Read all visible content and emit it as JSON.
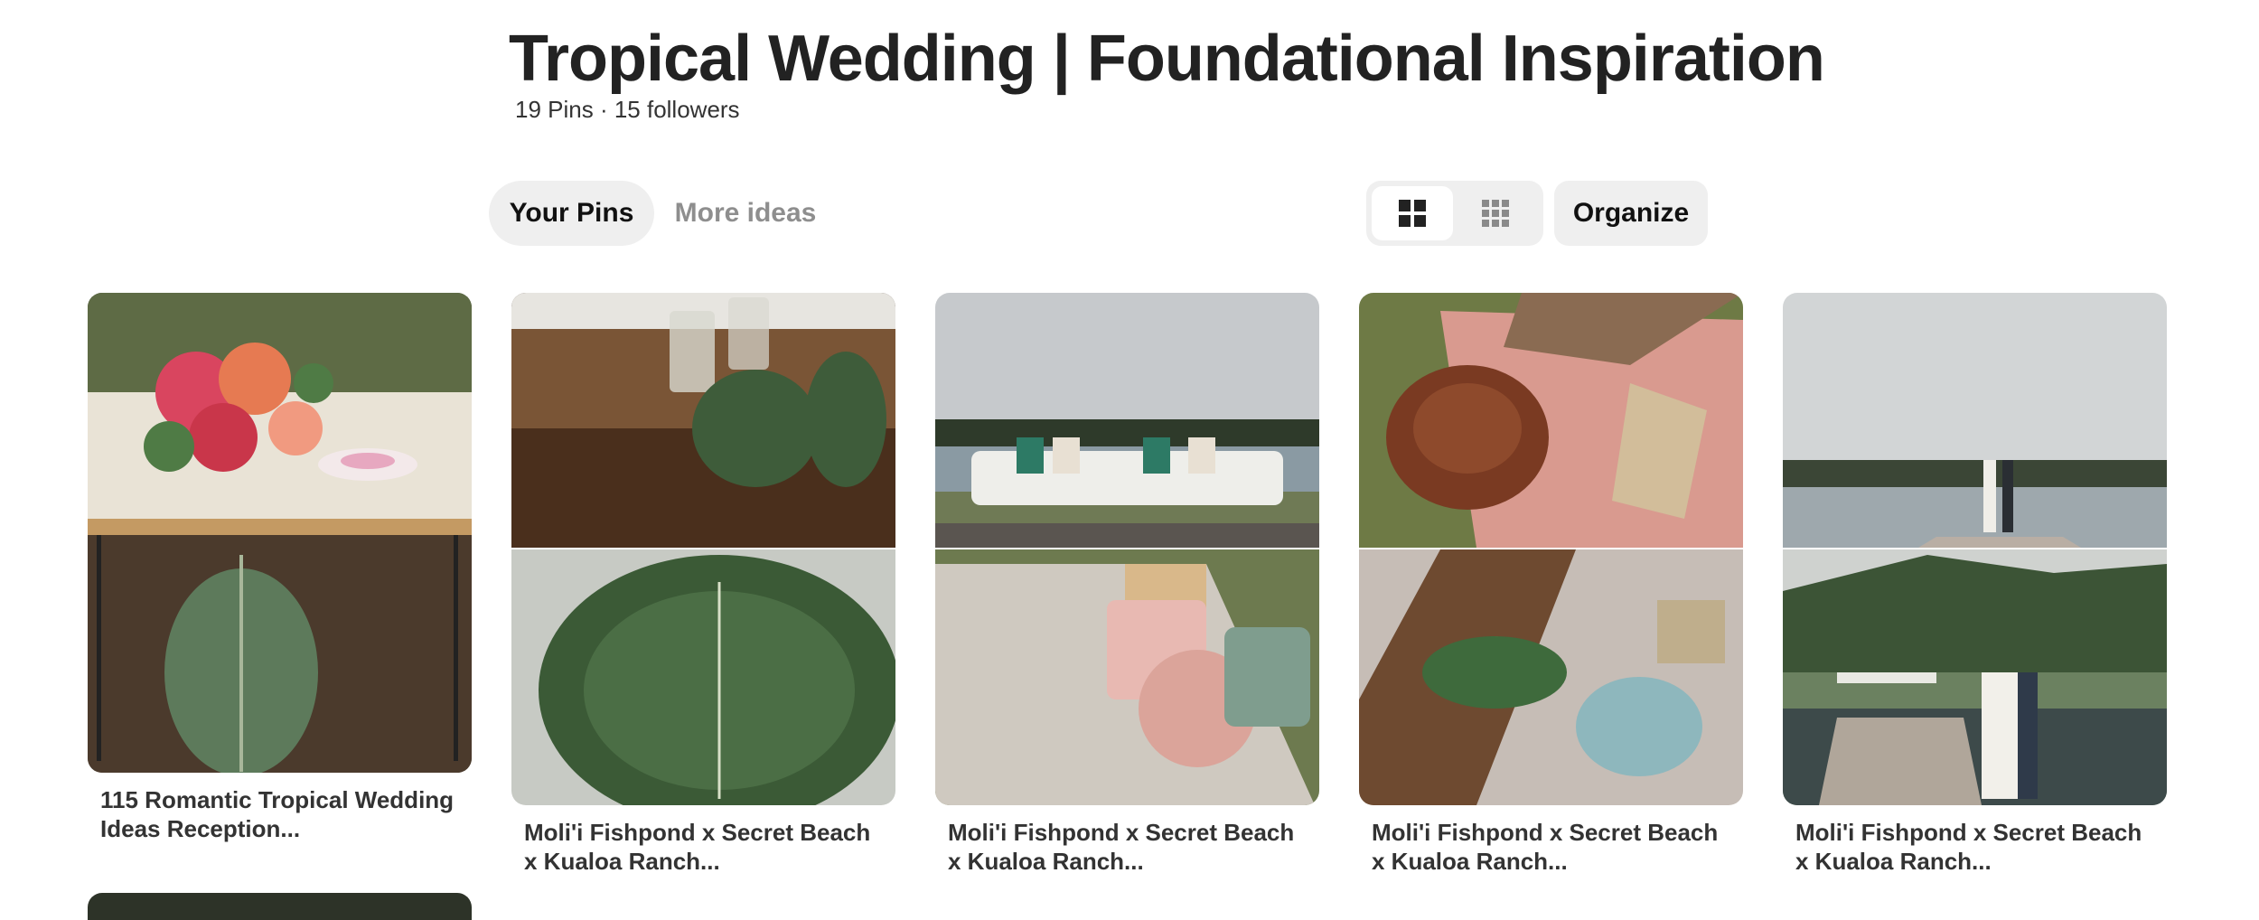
{
  "board": {
    "title": "Tropical Wedding | Foundational Inspiration",
    "meta": "19 Pins · 15 followers"
  },
  "tabs": [
    {
      "label": "Your Pins",
      "active": true
    },
    {
      "label": "More ideas",
      "active": false
    }
  ],
  "view_toggle": {
    "options": [
      {
        "icon": "large-grid-icon",
        "selected": true
      },
      {
        "icon": "compact-grid-icon",
        "selected": false
      }
    ]
  },
  "organize_label": "Organize",
  "pins": [
    {
      "title": "115 Romantic Tropical Wedding Ideas Reception..."
    },
    {
      "title": "Moli'i Fishpond x Secret Beach x Kualoa Ranch..."
    },
    {
      "title": "Moli'i Fishpond x Secret Beach x Kualoa Ranch..."
    },
    {
      "title": "Moli'i Fishpond x Secret Beach x Kualoa Ranch..."
    },
    {
      "title": "Moli'i Fishpond x Secret Beach x Kualoa Ranch..."
    }
  ],
  "colors": {
    "tab_active_bg": "#efefef",
    "text_muted": "#8e8e8e",
    "text_primary": "#111111"
  }
}
